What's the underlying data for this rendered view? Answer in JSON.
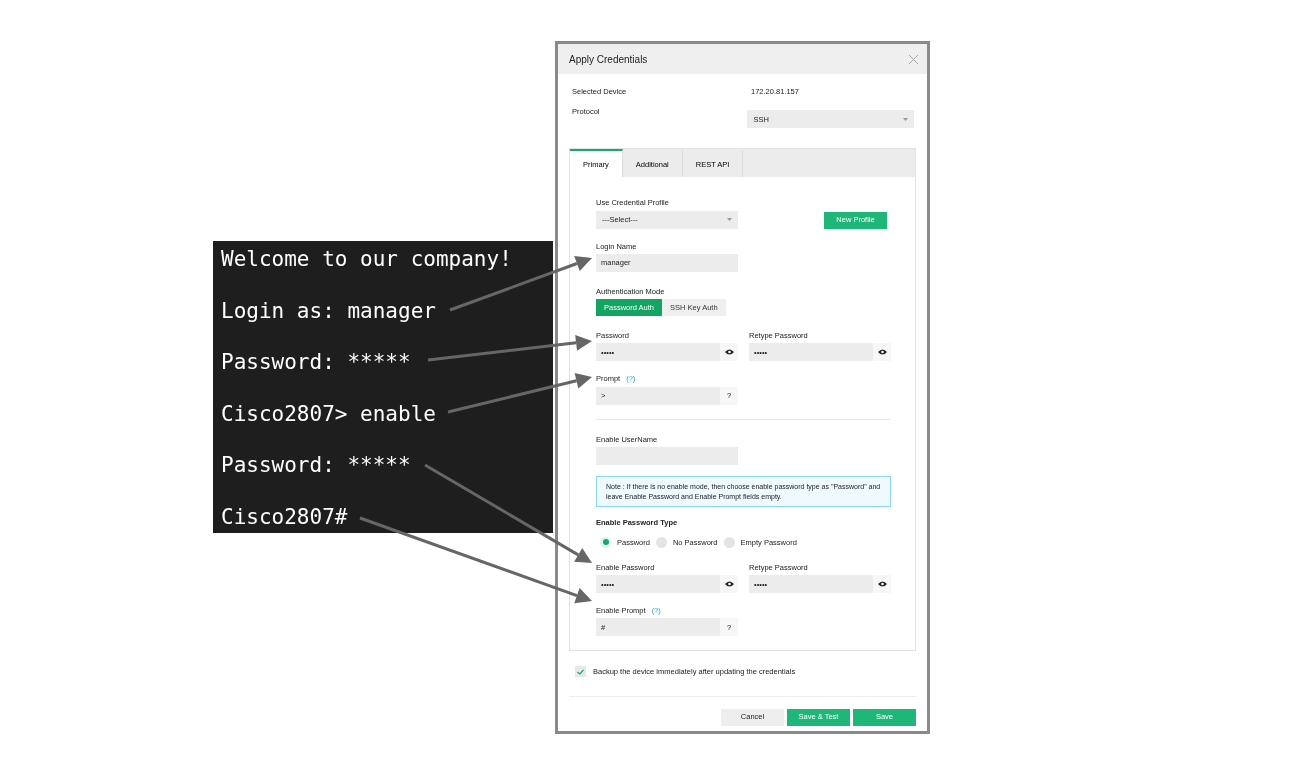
{
  "terminal": {
    "lines": [
      "Welcome to our company!",
      "Login as: manager",
      "Password: *****",
      "Cisco2807> enable",
      "Password: *****",
      "Cisco2807#"
    ]
  },
  "dialog": {
    "title": "Apply Credentials",
    "selected_device": {
      "label": "Selected Device",
      "value": "172.20.81.157"
    },
    "protocol": {
      "label": "Protocol",
      "value": "SSH"
    },
    "tabs": [
      {
        "label": "Primary",
        "selected": true
      },
      {
        "label": "Additional",
        "selected": false
      },
      {
        "label": "REST API",
        "selected": false
      }
    ],
    "credential_profile": {
      "label": "Use Credential Profile",
      "value": "---Select---",
      "button": "New Profile"
    },
    "login_name": {
      "label": "Login Name",
      "value": "manager"
    },
    "auth_mode": {
      "label": "Authentication Mode",
      "options": [
        {
          "label": "Password Auth",
          "selected": true
        },
        {
          "label": "SSH Key Auth",
          "selected": false
        }
      ]
    },
    "password": {
      "label": "Password",
      "value": "•••••"
    },
    "retype_password": {
      "label": "Retype Password",
      "value": "•••••"
    },
    "prompt": {
      "label": "Prompt",
      "help": "(?)",
      "value": ">",
      "button": "?"
    },
    "enable_username": {
      "label": "Enable UserName"
    },
    "note": "Note : If there is no enable mode, then choose enable password type as \"Password\" and leave Enable Password and Enable Prompt fields empty.",
    "enable_password_type": {
      "label": "Enable Password Type",
      "options": [
        {
          "label": "Password",
          "selected": true
        },
        {
          "label": "No Password",
          "selected": false
        },
        {
          "label": "Empty Password",
          "selected": false
        }
      ]
    },
    "enable_password": {
      "label": "Enable Password",
      "value": "•••••"
    },
    "enable_retype_password": {
      "label": "Retype Password",
      "value": "•••••"
    },
    "enable_prompt": {
      "label": "Enable Prompt",
      "help": "(?)",
      "value": "#",
      "button": "?"
    },
    "backup": {
      "label": "Backup the device immediately after updating the credentials",
      "checked": true
    },
    "buttons": [
      {
        "label": "Cancel",
        "kind": "secondary"
      },
      {
        "label": "Save & Test",
        "kind": "primary"
      },
      {
        "label": "Save",
        "kind": "primary"
      }
    ]
  }
}
